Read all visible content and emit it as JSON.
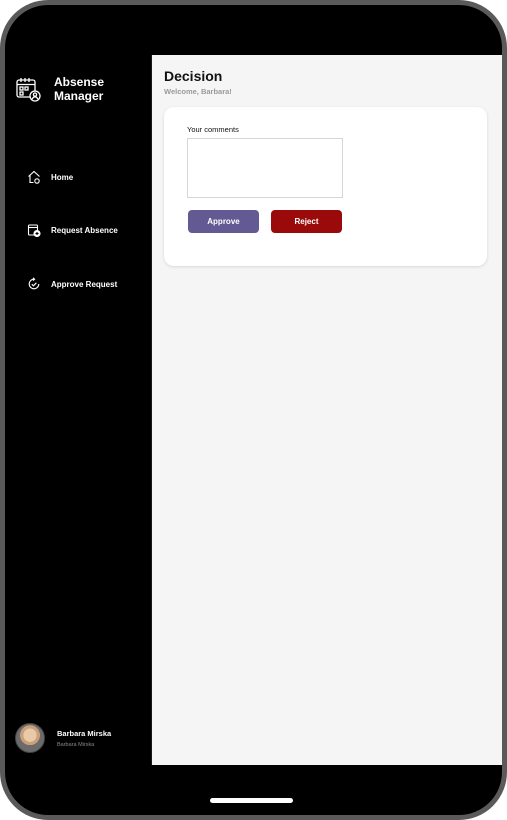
{
  "app": {
    "brand_line1": "Absense",
    "brand_line2": "Manager"
  },
  "sidebar": {
    "items": [
      {
        "label": "Home",
        "icon": "home-icon"
      },
      {
        "label": "Request Absence",
        "icon": "calendar-add-icon"
      },
      {
        "label": "Approve Request",
        "icon": "refresh-check-icon"
      }
    ]
  },
  "profile": {
    "name": "Barbara Mirska",
    "subtitle": "Barbara Mirska"
  },
  "main": {
    "title": "Decision",
    "subtitle": "Welcome, Barbara!",
    "form": {
      "comments_label": "Your comments",
      "comments_value": "",
      "comments_placeholder": "",
      "approve_label": "Approve",
      "reject_label": "Reject"
    }
  },
  "colors": {
    "approve": "#635a94",
    "reject": "#9b0a0a",
    "sidebar": "#000000",
    "content_bg": "#f5f5f5"
  }
}
